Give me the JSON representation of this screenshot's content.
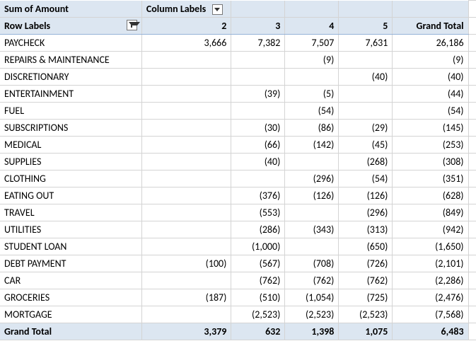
{
  "header": {
    "sum_label": "Sum of Amount",
    "col_labels": "Column Labels",
    "row_labels": "Row Labels",
    "columns": [
      "2",
      "3",
      "4",
      "5"
    ],
    "grand_total": "Grand Total"
  },
  "rows": [
    {
      "label": "PAYCHECK",
      "v": [
        "3,666",
        "7,382",
        "7,507",
        "7,631"
      ],
      "t": "26,186"
    },
    {
      "label": "REPAIRS & MAINTENANCE",
      "v": [
        "",
        "",
        "(9)",
        ""
      ],
      "t": "(9)"
    },
    {
      "label": "DISCRETIONARY",
      "v": [
        "",
        "",
        "",
        "(40)"
      ],
      "t": "(40)"
    },
    {
      "label": "ENTERTAINMENT",
      "v": [
        "",
        "(39)",
        "(5)",
        ""
      ],
      "t": "(44)"
    },
    {
      "label": "FUEL",
      "v": [
        "",
        "",
        "(54)",
        ""
      ],
      "t": "(54)"
    },
    {
      "label": "SUBSCRIPTIONS",
      "v": [
        "",
        "(30)",
        "(86)",
        "(29)"
      ],
      "t": "(145)"
    },
    {
      "label": "MEDICAL",
      "v": [
        "",
        "(66)",
        "(142)",
        "(45)"
      ],
      "t": "(253)"
    },
    {
      "label": "SUPPLIES",
      "v": [
        "",
        "(40)",
        "",
        "(268)"
      ],
      "t": "(308)"
    },
    {
      "label": "CLOTHING",
      "v": [
        "",
        "",
        "(296)",
        "(54)"
      ],
      "t": "(351)"
    },
    {
      "label": "EATING OUT",
      "v": [
        "",
        "(376)",
        "(126)",
        "(126)"
      ],
      "t": "(628)"
    },
    {
      "label": "TRAVEL",
      "v": [
        "",
        "(553)",
        "",
        "(296)"
      ],
      "t": "(849)"
    },
    {
      "label": "UTILITIES",
      "v": [
        "",
        "(286)",
        "(343)",
        "(313)"
      ],
      "t": "(942)"
    },
    {
      "label": "STUDENT LOAN",
      "v": [
        "",
        "(1,000)",
        "",
        "(650)"
      ],
      "t": "(1,650)"
    },
    {
      "label": "DEBT PAYMENT",
      "v": [
        "(100)",
        "(567)",
        "(708)",
        "(726)"
      ],
      "t": "(2,101)"
    },
    {
      "label": "CAR",
      "v": [
        "",
        "(762)",
        "(762)",
        "(762)"
      ],
      "t": "(2,286)"
    },
    {
      "label": "GROCERIES",
      "v": [
        "(187)",
        "(510)",
        "(1,054)",
        "(725)"
      ],
      "t": "(2,476)"
    },
    {
      "label": "MORTGAGE",
      "v": [
        "",
        "(2,523)",
        "(2,523)",
        "(2,523)"
      ],
      "t": "(7,568)"
    }
  ],
  "footer": {
    "label": "Grand Total",
    "v": [
      "3,379",
      "632",
      "1,398",
      "1,075"
    ],
    "t": "6,483"
  },
  "chart_data": {
    "type": "table",
    "title": "Sum of Amount",
    "columns": [
      "2",
      "3",
      "4",
      "5",
      "Grand Total"
    ],
    "rows": [
      {
        "category": "PAYCHECK",
        "values": [
          3666,
          7382,
          7507,
          7631,
          26186
        ]
      },
      {
        "category": "REPAIRS & MAINTENANCE",
        "values": [
          null,
          null,
          -9,
          null,
          -9
        ]
      },
      {
        "category": "DISCRETIONARY",
        "values": [
          null,
          null,
          null,
          -40,
          -40
        ]
      },
      {
        "category": "ENTERTAINMENT",
        "values": [
          null,
          -39,
          -5,
          null,
          -44
        ]
      },
      {
        "category": "FUEL",
        "values": [
          null,
          null,
          -54,
          null,
          -54
        ]
      },
      {
        "category": "SUBSCRIPTIONS",
        "values": [
          null,
          -30,
          -86,
          -29,
          -145
        ]
      },
      {
        "category": "MEDICAL",
        "values": [
          null,
          -66,
          -142,
          -45,
          -253
        ]
      },
      {
        "category": "SUPPLIES",
        "values": [
          null,
          -40,
          null,
          -268,
          -308
        ]
      },
      {
        "category": "CLOTHING",
        "values": [
          null,
          null,
          -296,
          -54,
          -351
        ]
      },
      {
        "category": "EATING OUT",
        "values": [
          null,
          -376,
          -126,
          -126,
          -628
        ]
      },
      {
        "category": "TRAVEL",
        "values": [
          null,
          -553,
          null,
          -296,
          -849
        ]
      },
      {
        "category": "UTILITIES",
        "values": [
          null,
          -286,
          -343,
          -313,
          -942
        ]
      },
      {
        "category": "STUDENT LOAN",
        "values": [
          null,
          -1000,
          null,
          -650,
          -1650
        ]
      },
      {
        "category": "DEBT PAYMENT",
        "values": [
          -100,
          -567,
          -708,
          -726,
          -2101
        ]
      },
      {
        "category": "CAR",
        "values": [
          null,
          -762,
          -762,
          -762,
          -2286
        ]
      },
      {
        "category": "GROCERIES",
        "values": [
          -187,
          -510,
          -1054,
          -725,
          -2476
        ]
      },
      {
        "category": "MORTGAGE",
        "values": [
          null,
          -2523,
          -2523,
          -2523,
          -7568
        ]
      }
    ],
    "grand_total": [
      3379,
      632,
      1398,
      1075,
      6483
    ]
  }
}
